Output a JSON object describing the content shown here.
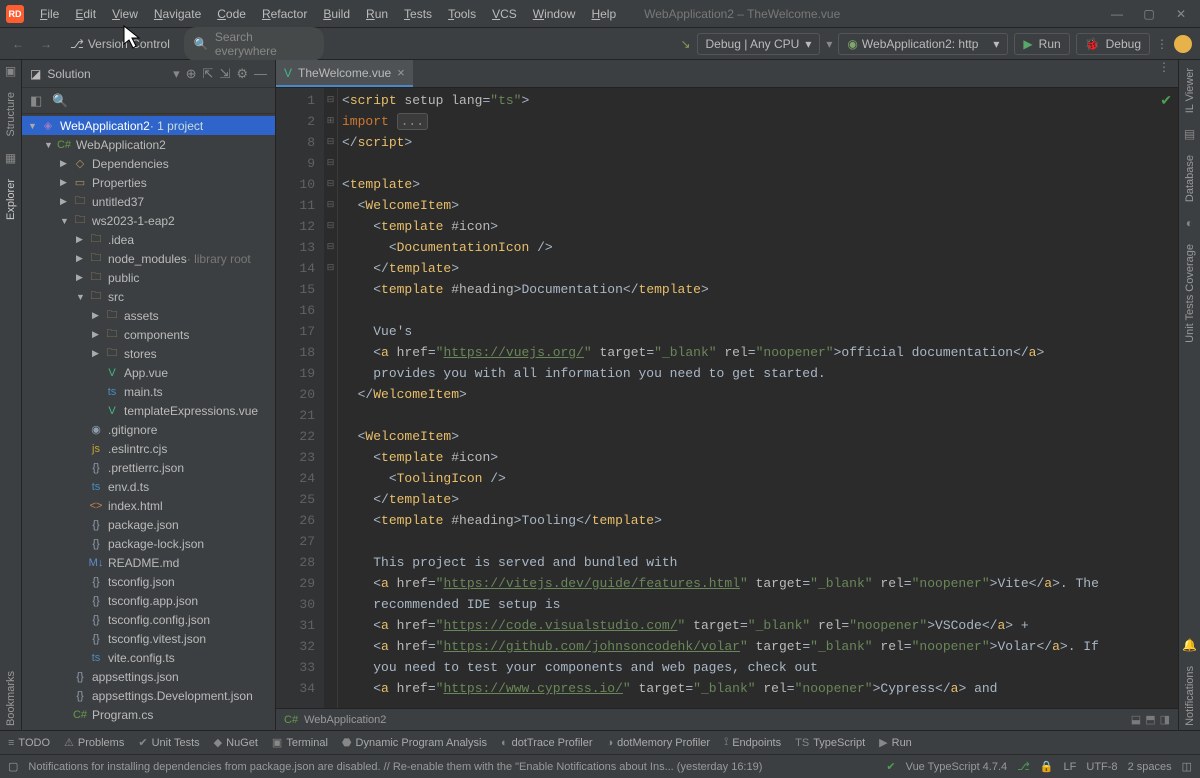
{
  "window": {
    "title": "WebApplication2 – TheWelcome.vue",
    "app_badge": "RD"
  },
  "menu": [
    "File",
    "Edit",
    "View",
    "Navigate",
    "Code",
    "Refactor",
    "Build",
    "Run",
    "Tests",
    "Tools",
    "VCS",
    "Window",
    "Help"
  ],
  "toolbar": {
    "vcs": "Version Control",
    "search_placeholder": "Search everywhere",
    "debug_config": "Debug | Any CPU",
    "run_config": "WebApplication2: http",
    "run_label": "Run",
    "debug_label": "Debug"
  },
  "sidebar": {
    "title": "Solution",
    "root": {
      "label": "WebApplication2",
      "suffix": "· 1 project"
    },
    "project": "WebApplication2",
    "tree": [
      {
        "indent": 1,
        "exp": "down",
        "icon": "cs-icon",
        "glyph": "C#",
        "label": "WebApplication2"
      },
      {
        "indent": 2,
        "exp": "right",
        "icon": "folder-icon",
        "glyph": "◇",
        "label": "Dependencies"
      },
      {
        "indent": 2,
        "exp": "right",
        "icon": "folder-icon",
        "glyph": "▭",
        "label": "Properties"
      },
      {
        "indent": 2,
        "exp": "right",
        "icon": "folder-icon",
        "glyph": "🗀",
        "label": "untitled37"
      },
      {
        "indent": 2,
        "exp": "down",
        "icon": "folder-icon",
        "glyph": "🗀",
        "label": "ws2023-1-eap2"
      },
      {
        "indent": 3,
        "exp": "right",
        "icon": "folder-icon",
        "glyph": "🗀",
        "label": ".idea"
      },
      {
        "indent": 3,
        "exp": "right",
        "icon": "folder-icon",
        "glyph": "🗀",
        "label": "node_modules",
        "suffix": " · library root"
      },
      {
        "indent": 3,
        "exp": "right",
        "icon": "folder-icon",
        "glyph": "🗀",
        "label": "public"
      },
      {
        "indent": 3,
        "exp": "down",
        "icon": "folder-icon",
        "glyph": "🗀",
        "label": "src"
      },
      {
        "indent": 4,
        "exp": "right",
        "icon": "folder-icon",
        "glyph": "🗀",
        "label": "assets"
      },
      {
        "indent": 4,
        "exp": "right",
        "icon": "folder-icon",
        "glyph": "🗀",
        "label": "components"
      },
      {
        "indent": 4,
        "exp": "right",
        "icon": "folder-icon",
        "glyph": "🗀",
        "label": "stores"
      },
      {
        "indent": 4,
        "exp": "none",
        "icon": "vue-icon",
        "glyph": "V",
        "label": "App.vue"
      },
      {
        "indent": 4,
        "exp": "none",
        "icon": "ts-icon",
        "glyph": "ts",
        "label": "main.ts"
      },
      {
        "indent": 4,
        "exp": "none",
        "icon": "vue-icon",
        "glyph": "V",
        "label": "templateExpressions.vue"
      },
      {
        "indent": 3,
        "exp": "none",
        "icon": "json-icon",
        "glyph": "◉",
        "label": ".gitignore"
      },
      {
        "indent": 3,
        "exp": "none",
        "icon": "js-icon",
        "glyph": "js",
        "label": ".eslintrc.cjs"
      },
      {
        "indent": 3,
        "exp": "none",
        "icon": "json-icon",
        "glyph": "{}",
        "label": ".prettierrc.json"
      },
      {
        "indent": 3,
        "exp": "none",
        "icon": "ts-icon",
        "glyph": "ts",
        "label": "env.d.ts"
      },
      {
        "indent": 3,
        "exp": "none",
        "icon": "html-icon",
        "glyph": "<>",
        "label": "index.html"
      },
      {
        "indent": 3,
        "exp": "none",
        "icon": "json-icon",
        "glyph": "{}",
        "label": "package.json"
      },
      {
        "indent": 3,
        "exp": "none",
        "icon": "json-icon",
        "glyph": "{}",
        "label": "package-lock.json"
      },
      {
        "indent": 3,
        "exp": "none",
        "icon": "md-icon",
        "glyph": "M↓",
        "label": "README.md"
      },
      {
        "indent": 3,
        "exp": "none",
        "icon": "json-icon",
        "glyph": "{}",
        "label": "tsconfig.json"
      },
      {
        "indent": 3,
        "exp": "none",
        "icon": "json-icon",
        "glyph": "{}",
        "label": "tsconfig.app.json"
      },
      {
        "indent": 3,
        "exp": "none",
        "icon": "json-icon",
        "glyph": "{}",
        "label": "tsconfig.config.json"
      },
      {
        "indent": 3,
        "exp": "none",
        "icon": "json-icon",
        "glyph": "{}",
        "label": "tsconfig.vitest.json"
      },
      {
        "indent": 3,
        "exp": "none",
        "icon": "ts-icon",
        "glyph": "ts",
        "label": "vite.config.ts"
      },
      {
        "indent": 2,
        "exp": "none",
        "icon": "json-icon",
        "glyph": "{}",
        "label": "appsettings.json"
      },
      {
        "indent": 2,
        "exp": "none",
        "icon": "json-icon",
        "glyph": "{}",
        "label": "appsettings.Development.json"
      },
      {
        "indent": 2,
        "exp": "none",
        "icon": "cs-icon",
        "glyph": "C#",
        "label": "Program.cs"
      }
    ]
  },
  "left_gutter": [
    "Structure",
    "Explorer",
    "Bookmarks"
  ],
  "right_gutter": [
    "IL Viewer",
    "Database",
    "Unit Tests Coverage",
    "Notifications"
  ],
  "tabs": [
    {
      "label": "TheWelcome.vue"
    }
  ],
  "line_numbers": [
    1,
    2,
    8,
    9,
    10,
    11,
    12,
    13,
    14,
    15,
    16,
    17,
    18,
    19,
    20,
    21,
    22,
    23,
    24,
    25,
    26,
    27,
    28,
    29,
    30,
    31,
    32,
    33,
    34
  ],
  "breadcrumb": {
    "label": "WebApplication2"
  },
  "bottom": [
    "TODO",
    "Problems",
    "Unit Tests",
    "NuGet",
    "Terminal",
    "Dynamic Program Analysis",
    "dotTrace Profiler",
    "dotMemory Profiler",
    "Endpoints",
    "TypeScript",
    "Run"
  ],
  "status": {
    "msg": "Notifications for installing dependencies from package.json are disabled. // Re-enable them with the \"Enable Notifications about Ins... (yesterday 16:19)",
    "vue": "Vue TypeScript 4.7.4",
    "lf": "LF",
    "enc": "UTF-8",
    "indent": "2 spaces"
  },
  "editor_code": {
    "lines": [
      [
        [
          "t-punct",
          "<"
        ],
        [
          "t-tag",
          "script "
        ],
        [
          "t-attr",
          "setup "
        ],
        [
          "t-attr",
          "lang"
        ],
        [
          "t-punct",
          "="
        ],
        [
          "t-str",
          "\"ts\""
        ],
        [
          "t-punct",
          ">"
        ]
      ],
      [
        [
          "t-kwd",
          "import "
        ],
        [
          "t-dots",
          "..."
        ]
      ],
      [
        [
          "t-punct",
          "</"
        ],
        [
          "t-tag",
          "script"
        ],
        [
          "t-punct",
          ">"
        ]
      ],
      [],
      [
        [
          "t-punct",
          "<"
        ],
        [
          "t-tag",
          "template"
        ],
        [
          "t-punct",
          ">"
        ]
      ],
      [
        [
          "pad",
          "  "
        ],
        [
          "t-punct",
          "<"
        ],
        [
          "t-comp",
          "WelcomeItem"
        ],
        [
          "t-punct",
          ">"
        ]
      ],
      [
        [
          "pad",
          "    "
        ],
        [
          "t-punct",
          "<"
        ],
        [
          "t-tag",
          "template "
        ],
        [
          "t-attr",
          "#icon"
        ],
        [
          "t-punct",
          ">"
        ]
      ],
      [
        [
          "pad",
          "      "
        ],
        [
          "t-punct",
          "<"
        ],
        [
          "t-comp",
          "DocumentationIcon "
        ],
        [
          "t-punct",
          "/>"
        ]
      ],
      [
        [
          "pad",
          "    "
        ],
        [
          "t-punct",
          "</"
        ],
        [
          "t-tag",
          "template"
        ],
        [
          "t-punct",
          ">"
        ]
      ],
      [
        [
          "pad",
          "    "
        ],
        [
          "t-punct",
          "<"
        ],
        [
          "t-tag",
          "template "
        ],
        [
          "t-attr",
          "#heading"
        ],
        [
          "t-punct",
          ">"
        ],
        [
          "t-text",
          "Documentation"
        ],
        [
          "t-punct",
          "</"
        ],
        [
          "t-tag",
          "template"
        ],
        [
          "t-punct",
          ">"
        ]
      ],
      [],
      [
        [
          "pad",
          "    "
        ],
        [
          "t-text",
          "Vue's"
        ]
      ],
      [
        [
          "pad",
          "    "
        ],
        [
          "t-punct",
          "<"
        ],
        [
          "t-tag",
          "a "
        ],
        [
          "t-attr",
          "href"
        ],
        [
          "t-punct",
          "="
        ],
        [
          "t-str",
          "\""
        ],
        [
          "t-link",
          "https://vuejs.org/"
        ],
        [
          "t-str",
          "\" "
        ],
        [
          "t-attr",
          "target"
        ],
        [
          "t-punct",
          "="
        ],
        [
          "t-str",
          "\"_blank\" "
        ],
        [
          "t-attr",
          "rel"
        ],
        [
          "t-punct",
          "="
        ],
        [
          "t-str",
          "\"noopener\""
        ],
        [
          "t-punct",
          ">"
        ],
        [
          "t-text",
          "official documentation"
        ],
        [
          "t-punct",
          "</"
        ],
        [
          "t-tag",
          "a"
        ],
        [
          "t-punct",
          ">"
        ]
      ],
      [
        [
          "pad",
          "    "
        ],
        [
          "t-text",
          "provides you with all information you need to get started."
        ]
      ],
      [
        [
          "pad",
          "  "
        ],
        [
          "t-punct",
          "</"
        ],
        [
          "t-comp",
          "WelcomeItem"
        ],
        [
          "t-punct",
          ">"
        ]
      ],
      [],
      [
        [
          "pad",
          "  "
        ],
        [
          "t-punct",
          "<"
        ],
        [
          "t-comp",
          "WelcomeItem"
        ],
        [
          "t-punct",
          ">"
        ]
      ],
      [
        [
          "pad",
          "    "
        ],
        [
          "t-punct",
          "<"
        ],
        [
          "t-tag",
          "template "
        ],
        [
          "t-attr",
          "#icon"
        ],
        [
          "t-punct",
          ">"
        ]
      ],
      [
        [
          "pad",
          "      "
        ],
        [
          "t-punct",
          "<"
        ],
        [
          "t-comp",
          "ToolingIcon "
        ],
        [
          "t-punct",
          "/>"
        ]
      ],
      [
        [
          "pad",
          "    "
        ],
        [
          "t-punct",
          "</"
        ],
        [
          "t-tag",
          "template"
        ],
        [
          "t-punct",
          ">"
        ]
      ],
      [
        [
          "pad",
          "    "
        ],
        [
          "t-punct",
          "<"
        ],
        [
          "t-tag",
          "template "
        ],
        [
          "t-attr",
          "#heading"
        ],
        [
          "t-punct",
          ">"
        ],
        [
          "t-text",
          "Tooling"
        ],
        [
          "t-punct",
          "</"
        ],
        [
          "t-tag",
          "template"
        ],
        [
          "t-punct",
          ">"
        ]
      ],
      [],
      [
        [
          "pad",
          "    "
        ],
        [
          "t-text",
          "This project is served and bundled with"
        ]
      ],
      [
        [
          "pad",
          "    "
        ],
        [
          "t-punct",
          "<"
        ],
        [
          "t-tag",
          "a "
        ],
        [
          "t-attr",
          "href"
        ],
        [
          "t-punct",
          "="
        ],
        [
          "t-str",
          "\""
        ],
        [
          "t-link",
          "https://vitejs.dev/guide/features.html"
        ],
        [
          "t-str",
          "\" "
        ],
        [
          "t-attr",
          "target"
        ],
        [
          "t-punct",
          "="
        ],
        [
          "t-str",
          "\"_blank\" "
        ],
        [
          "t-attr",
          "rel"
        ],
        [
          "t-punct",
          "="
        ],
        [
          "t-str",
          "\"noopener\""
        ],
        [
          "t-punct",
          ">"
        ],
        [
          "t-text",
          "Vite"
        ],
        [
          "t-punct",
          "</"
        ],
        [
          "t-tag",
          "a"
        ],
        [
          "t-punct",
          ">"
        ],
        [
          "t-text",
          ". The"
        ]
      ],
      [
        [
          "pad",
          "    "
        ],
        [
          "t-text",
          "recommended IDE setup is"
        ]
      ],
      [
        [
          "pad",
          "    "
        ],
        [
          "t-punct",
          "<"
        ],
        [
          "t-tag",
          "a "
        ],
        [
          "t-attr",
          "href"
        ],
        [
          "t-punct",
          "="
        ],
        [
          "t-str",
          "\""
        ],
        [
          "t-link",
          "https://code.visualstudio.com/"
        ],
        [
          "t-str",
          "\" "
        ],
        [
          "t-attr",
          "target"
        ],
        [
          "t-punct",
          "="
        ],
        [
          "t-str",
          "\"_blank\" "
        ],
        [
          "t-attr",
          "rel"
        ],
        [
          "t-punct",
          "="
        ],
        [
          "t-str",
          "\"noopener\""
        ],
        [
          "t-punct",
          ">"
        ],
        [
          "t-text",
          "VSCode"
        ],
        [
          "t-punct",
          "</"
        ],
        [
          "t-tag",
          "a"
        ],
        [
          "t-punct",
          ">"
        ],
        [
          "t-text",
          " +"
        ]
      ],
      [
        [
          "pad",
          "    "
        ],
        [
          "t-punct",
          "<"
        ],
        [
          "t-tag",
          "a "
        ],
        [
          "t-attr",
          "href"
        ],
        [
          "t-punct",
          "="
        ],
        [
          "t-str",
          "\""
        ],
        [
          "t-link",
          "https://github.com/johnsoncodehk/volar"
        ],
        [
          "t-str",
          "\" "
        ],
        [
          "t-attr",
          "target"
        ],
        [
          "t-punct",
          "="
        ],
        [
          "t-str",
          "\"_blank\" "
        ],
        [
          "t-attr",
          "rel"
        ],
        [
          "t-punct",
          "="
        ],
        [
          "t-str",
          "\"noopener\""
        ],
        [
          "t-punct",
          ">"
        ],
        [
          "t-text",
          "Volar"
        ],
        [
          "t-punct",
          "</"
        ],
        [
          "t-tag",
          "a"
        ],
        [
          "t-punct",
          ">"
        ],
        [
          "t-text",
          ". If"
        ]
      ],
      [
        [
          "pad",
          "    "
        ],
        [
          "t-text",
          "you need to test your components and web pages, check out"
        ]
      ],
      [
        [
          "pad",
          "    "
        ],
        [
          "t-punct",
          "<"
        ],
        [
          "t-tag",
          "a "
        ],
        [
          "t-attr",
          "href"
        ],
        [
          "t-punct",
          "="
        ],
        [
          "t-str",
          "\""
        ],
        [
          "t-link",
          "https://www.cypress.io/"
        ],
        [
          "t-str",
          "\" "
        ],
        [
          "t-attr",
          "target"
        ],
        [
          "t-punct",
          "="
        ],
        [
          "t-str",
          "\"_blank\" "
        ],
        [
          "t-attr",
          "rel"
        ],
        [
          "t-punct",
          "="
        ],
        [
          "t-str",
          "\"noopener\""
        ],
        [
          "t-punct",
          ">"
        ],
        [
          "t-text",
          "Cypress"
        ],
        [
          "t-punct",
          "</"
        ],
        [
          "t-tag",
          "a"
        ],
        [
          "t-punct",
          ">"
        ],
        [
          "t-text",
          " and"
        ]
      ]
    ]
  }
}
